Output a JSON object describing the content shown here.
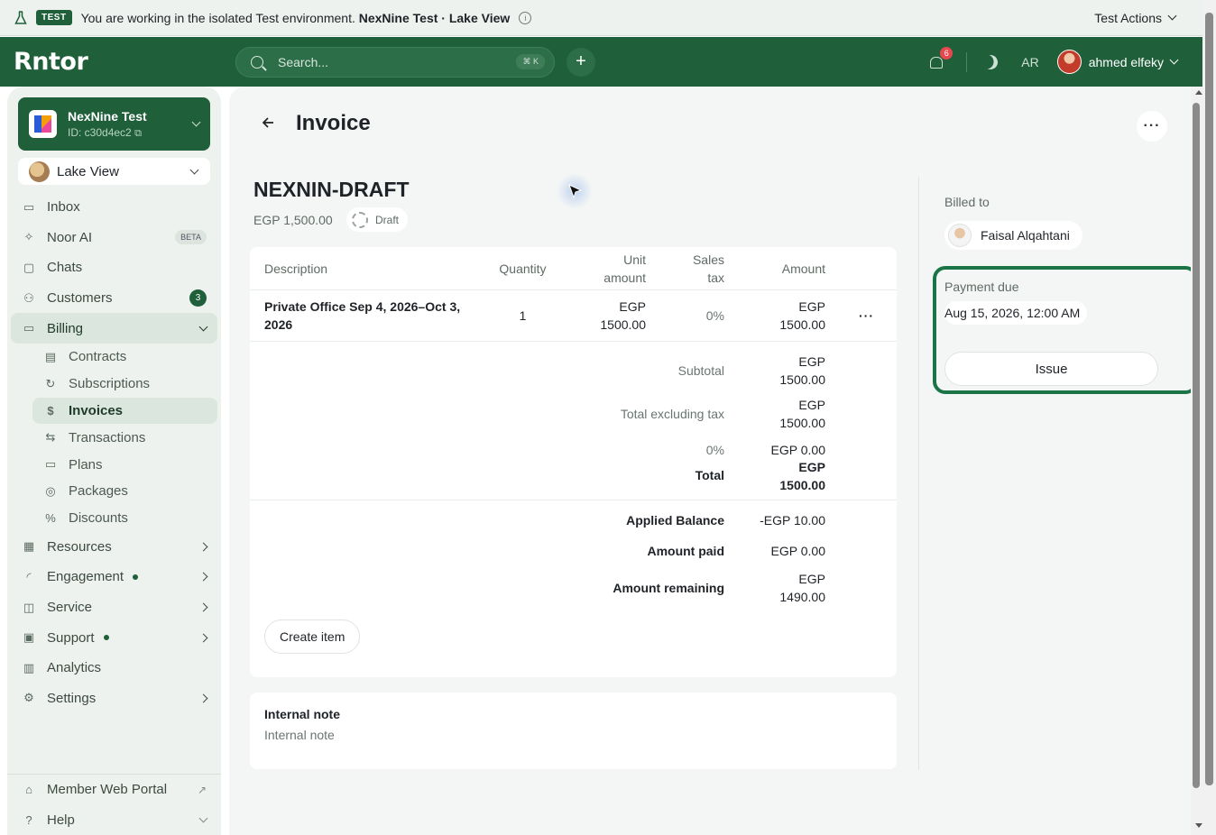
{
  "banner": {
    "badge": "TEST",
    "text": "You are working in the isolated Test environment.",
    "org_location": "NexNine Test · Lake View",
    "actions_label": "Test Actions"
  },
  "topbar": {
    "logo": "Rntor",
    "search_placeholder": "Search...",
    "search_shortcut": "⌘ K",
    "notifications_count": "6",
    "language": "AR",
    "user_name": "ahmed elfeky"
  },
  "sidebar": {
    "org_name": "NexNine Test",
    "org_id": "ID: c30d4ec2",
    "location": "Lake View",
    "items": [
      {
        "label": "Inbox"
      },
      {
        "label": "Noor AI",
        "badge": "BETA"
      },
      {
        "label": "Chats"
      },
      {
        "label": "Customers",
        "count": "3"
      },
      {
        "label": "Billing"
      }
    ],
    "billing_sub": [
      {
        "label": "Contracts"
      },
      {
        "label": "Subscriptions"
      },
      {
        "label": "Invoices"
      },
      {
        "label": "Transactions"
      },
      {
        "label": "Plans"
      },
      {
        "label": "Packages"
      },
      {
        "label": "Discounts"
      }
    ],
    "more_items": [
      {
        "label": "Resources"
      },
      {
        "label": "Engagement"
      },
      {
        "label": "Service"
      },
      {
        "label": "Support"
      },
      {
        "label": "Analytics"
      },
      {
        "label": "Settings"
      }
    ],
    "bottom": [
      {
        "label": "Member Web Portal"
      },
      {
        "label": "Help"
      }
    ]
  },
  "page": {
    "title": "Invoice",
    "invoice_number": "NEXNIN-DRAFT",
    "amount": "EGP 1,500.00",
    "status": "Draft"
  },
  "table": {
    "headers": {
      "description": "Description",
      "quantity": "Quantity",
      "unit_amount": "Unit amount",
      "sales_tax": "Sales tax",
      "amount": "Amount"
    },
    "rows": [
      {
        "description": "Private Office Sep 4, 2026–Oct 3, 2026",
        "quantity": "1",
        "unit_amount": "EGP 1500.00",
        "sales_tax": "0%",
        "amount": "EGP 1500.00"
      }
    ],
    "subtotal_label": "Subtotal",
    "subtotal": "EGP 1500.00",
    "excl_tax_label": "Total excluding tax",
    "excl_tax": "EGP 1500.00",
    "tax_rate": "0%",
    "tax_amount": "EGP 0.00",
    "total_label": "Total",
    "total": "EGP 1500.00",
    "applied_balance_label": "Applied Balance",
    "applied_balance": "-EGP 10.00",
    "amount_paid_label": "Amount paid",
    "amount_paid": "EGP 0.00",
    "amount_remaining_label": "Amount remaining",
    "amount_remaining": "EGP 1490.00",
    "create_item": "Create item"
  },
  "note": {
    "label": "Internal note",
    "placeholder": "Internal note"
  },
  "right": {
    "billed_to_label": "Billed to",
    "customer": "Faisal Alqahtani",
    "payment_due_label": "Payment due",
    "payment_due": "Aug 15, 2026, 12:00 AM",
    "issue_button": "Issue"
  },
  "colors": {
    "brand": "#1f5f3a",
    "highlight": "#1a7446"
  }
}
